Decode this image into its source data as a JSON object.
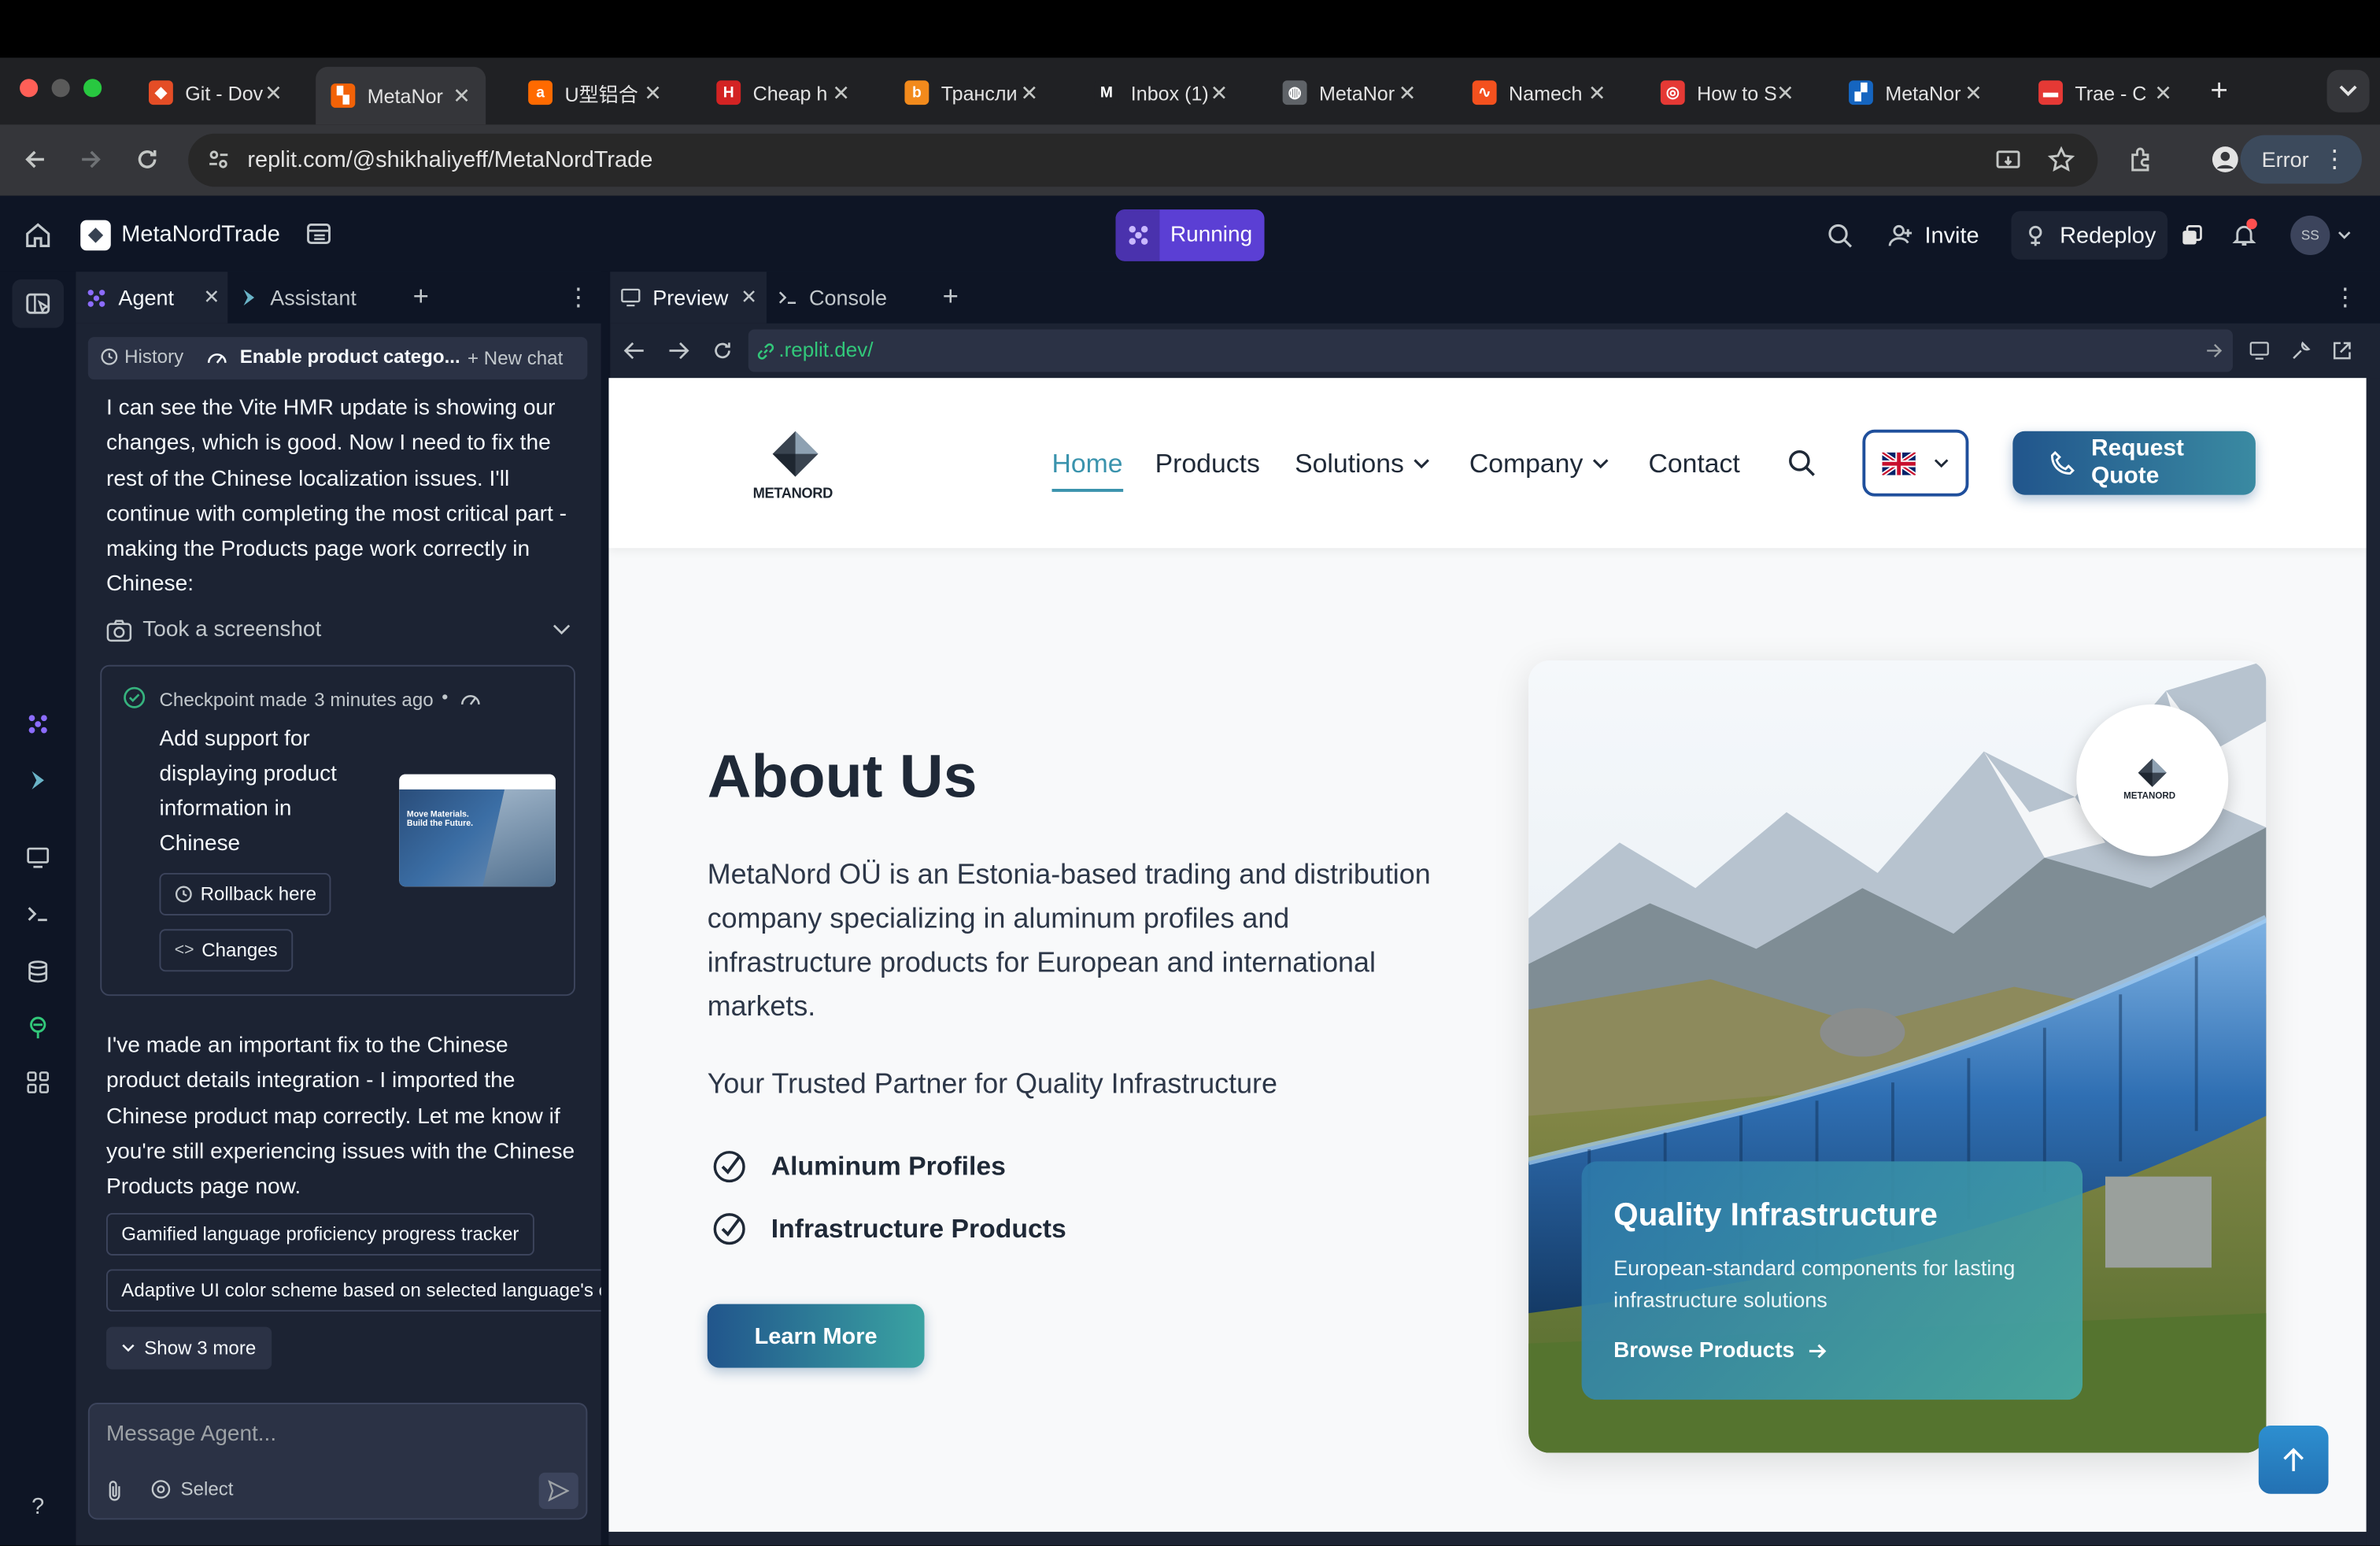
{
  "browser": {
    "tabs": [
      {
        "title": "Git - Dov",
        "fav_color": "#e44d26",
        "fav_glyph": "◆"
      },
      {
        "title": "MetaNor",
        "fav_color": "#f26207",
        "fav_glyph": "▚",
        "active": true
      },
      {
        "title": "U型铝合",
        "fav_color": "#ff6a00",
        "fav_glyph": "a"
      },
      {
        "title": "Cheap h",
        "fav_color": "#d32323",
        "fav_glyph": "H"
      },
      {
        "title": "Трансли",
        "fav_color": "#f28a1c",
        "fav_glyph": "b"
      },
      {
        "title": "Inbox (1)",
        "fav_color": "#202124",
        "fav_glyph": "M"
      },
      {
        "title": "MetaNor",
        "fav_color": "#5f6368",
        "fav_glyph": "◍"
      },
      {
        "title": "Namech",
        "fav_color": "#f4511e",
        "fav_glyph": "∿"
      },
      {
        "title": "How to S",
        "fav_color": "#e53935",
        "fav_glyph": "◎"
      },
      {
        "title": "MetaNor",
        "fav_color": "#1565c0",
        "fav_glyph": "▞"
      },
      {
        "title": "Trae - C",
        "fav_color": "#e53935",
        "fav_glyph": "▬"
      }
    ],
    "url": "replit.com/@shikhaliyeff/MetaNordTrade",
    "status_pill": "Error"
  },
  "topbar": {
    "project_name": "MetaNordTrade",
    "run_status": "Running",
    "invite_label": "Invite",
    "redeploy_label": "Redeploy",
    "avatar_initials": "SS"
  },
  "agent_panel": {
    "tabs": [
      "Agent",
      "Assistant"
    ],
    "history_label": "History",
    "thread_title": "Enable product catego...",
    "new_chat_label": "+ New chat",
    "message_1": "I can see the Vite HMR update is showing our changes, which is good. Now I need to fix the rest of the Chinese localization issues. I'll continue with completing the most critical part - making the Products page work correctly in Chinese:",
    "screenshot_label": "Took a screenshot",
    "checkpoint": {
      "made_label": "Checkpoint made",
      "time": "3 minutes ago",
      "description": "Add support for displaying product information in Chinese",
      "rollback_label": "Rollback here",
      "changes_label": "Changes",
      "thumb_text": "Move Materials. Build the Future."
    },
    "message_2": "I've made an important fix to the Chinese product details integration - I imported the Chinese product map correctly. Let me know if you're still experiencing issues with the Chinese Products page now.",
    "suggestions": [
      "Gamified language proficiency progress tracker",
      "Adaptive UI color scheme based on selected language's c"
    ],
    "show_more_label": "Show 3 more",
    "input_placeholder": "Message Agent...",
    "select_label": "Select"
  },
  "preview_panel": {
    "tabs": [
      "Preview",
      "Console"
    ],
    "url": ".replit.dev/"
  },
  "site": {
    "logo_text": "METANORD",
    "nav": [
      "Home",
      "Products",
      "Solutions",
      "Company",
      "Contact"
    ],
    "cta_label": "Request Quote",
    "heading": "About Us",
    "intro": "MetaNord OÜ is an Estonia-based trading and distribution company specializing in aluminum profiles and infrastructure products for European and international markets.",
    "tagline": "Your Trusted Partner for Quality Infrastructure",
    "features": [
      "Aluminum Profiles",
      "Infrastructure Products"
    ],
    "learn_more_label": "Learn More",
    "card_badge_text": "METANORD",
    "card_title": "Quality Infrastructure",
    "card_text": "European-standard components for lasting infrastructure solutions",
    "card_link": "Browse Products"
  }
}
